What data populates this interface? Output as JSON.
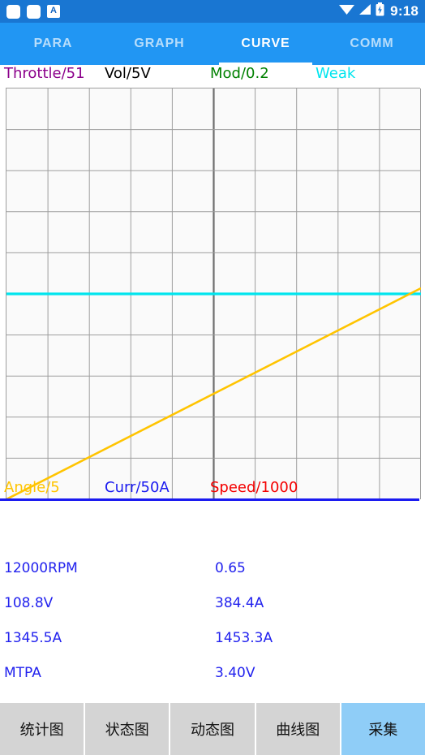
{
  "status_bar": {
    "icons": [
      "notification-square",
      "notification-square",
      "ime-indicator"
    ],
    "ime_letter": "A",
    "wifi": "wifi-icon",
    "signal": "signal-icon",
    "battery": "battery-charging-icon",
    "time": "9:18",
    "background": "#1976d2"
  },
  "tabs": {
    "items": [
      {
        "label": "PARA",
        "active": false
      },
      {
        "label": "GRAPH",
        "active": false
      },
      {
        "label": "CURVE",
        "active": true
      },
      {
        "label": "COMM",
        "active": false
      }
    ],
    "background": "#2196f3",
    "active_color": "#ffffff",
    "inactive_color": "#b9dcfa"
  },
  "chart_data": {
    "type": "line",
    "title": "",
    "xlabel": "",
    "ylabel": "",
    "grid": true,
    "grid_cols": 10,
    "grid_rows": 10,
    "xlim": [
      0,
      10
    ],
    "ylim": [
      0,
      10
    ],
    "legend_top": [
      {
        "label": "Throttle/51",
        "color": "#8b008b"
      },
      {
        "label": "Vol/5V",
        "color": "#000000"
      },
      {
        "label": "Mod/0.2",
        "color": "#008000"
      },
      {
        "label": "Weak",
        "color": "#00e5ee"
      }
    ],
    "legend_bottom": [
      {
        "label": "Angle/5",
        "color": "#ffc400"
      },
      {
        "label": "Curr/50A",
        "color": "#1a1af0"
      },
      {
        "label": "Speed/1000",
        "color": "#f40000"
      }
    ],
    "series": [
      {
        "name": "Weak",
        "color": "#00e5ee",
        "x": [
          0,
          10
        ],
        "y": [
          5.0,
          5.0
        ]
      },
      {
        "name": "Angle/5",
        "color": "#ffc400",
        "x": [
          0,
          10
        ],
        "y": [
          0.0,
          5.15
        ]
      },
      {
        "name": "Throttle/51",
        "color": "#8b008b",
        "x": [],
        "y": []
      },
      {
        "name": "Vol/5V",
        "color": "#000000",
        "x": [],
        "y": []
      },
      {
        "name": "Mod/0.2",
        "color": "#008000",
        "x": [],
        "y": []
      },
      {
        "name": "Curr/50A",
        "color": "#1a1af0",
        "x": [],
        "y": []
      },
      {
        "name": "Speed/1000",
        "color": "#f40000",
        "x": [],
        "y": []
      }
    ]
  },
  "readouts": {
    "rows": [
      {
        "left": "12000RPM",
        "right": "0.65"
      },
      {
        "left": "108.8V",
        "right": "384.4A"
      },
      {
        "left": "1345.5A",
        "right": "1453.3A"
      },
      {
        "left": "MTPA",
        "right": "3.40V"
      }
    ],
    "color": "#2222ee"
  },
  "button_bar": {
    "buttons": [
      {
        "label": "统计图",
        "highlighted": false
      },
      {
        "label": "状态图",
        "highlighted": false
      },
      {
        "label": "动态图",
        "highlighted": false
      },
      {
        "label": "曲线图",
        "highlighted": false
      },
      {
        "label": "采集",
        "highlighted": true
      }
    ],
    "default_background": "#d4d4d4",
    "highlight_background": "#8fcdf7"
  }
}
